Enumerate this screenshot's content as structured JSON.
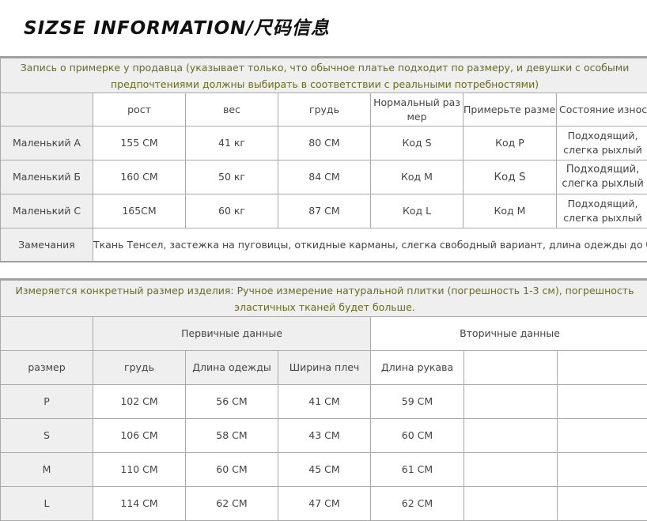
{
  "title": "SIZSE INFORMATION/尺码信息",
  "table1": {
    "header": "Запись о примерке у продавца (указывает только, что обычное платье подходит по размеру, и девушки с особыми предпочтениями должны выбирать в соответствии с реальными потребностями)",
    "columns": [
      "",
      "рост",
      "вес",
      "грудь",
      "Нормальный размер",
      "Примерьте размер",
      "Состояние износа"
    ],
    "rows": [
      [
        "Маленький А",
        "155 CM",
        "41 кг",
        "80 CM",
        "Код S",
        "Код P",
        "Подходящий, слегка рыхлый"
      ],
      [
        "Маленький Б",
        "160 CM",
        "50 кг",
        "84 CM",
        "Код M",
        "Код S",
        "Подходящий, слегка рыхлый"
      ],
      [
        "Маленький С",
        "165CM",
        "60 кг",
        "87 CM",
        "Код L",
        "Код M",
        "Подходящий, слегка рыхлый"
      ]
    ],
    "remarks_label": "Замечания",
    "remarks_text": "Ткань Тенсел, застежка на пуговицы, откидные карманы, слегка свободный вариант, длина одежды до бедер"
  },
  "table2": {
    "header": "Измеряется конкретный размер изделия: Ручное измерение натуральной плитки (погрешность 1-3 см), погрешность эластичных тканей будет больше.",
    "group_primary": "Первичные данные",
    "group_secondary": "Вторичные данные",
    "columns": [
      "размер",
      "грудь",
      "Длина одежды",
      "Ширина плеч",
      "Длина рукава",
      "",
      ""
    ],
    "rows": [
      [
        "P",
        "102 CM",
        "56 CM",
        "41 CM",
        "59 CM",
        "",
        ""
      ],
      [
        "S",
        "106 CM",
        "58 CM",
        "43 CM",
        "60 CM",
        "",
        ""
      ],
      [
        "M",
        "110 CM",
        "60 CM",
        "45 CM",
        "61 CM",
        "",
        ""
      ],
      [
        "L",
        "114 CM",
        "62 CM",
        "47 CM",
        "62 CM",
        "",
        ""
      ]
    ]
  }
}
